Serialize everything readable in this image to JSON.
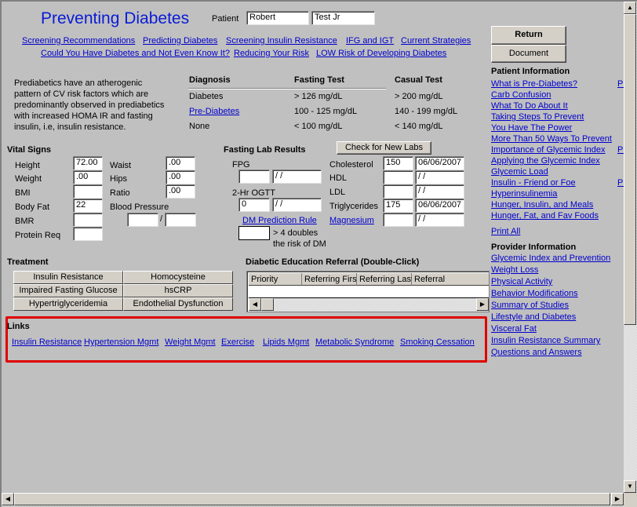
{
  "header": {
    "title": "Preventing Diabetes",
    "patient_label": "Patient",
    "first_name": "Robert",
    "last_name": "Test Jr"
  },
  "top_links": [
    "Screening Recommendations",
    "Predicting Diabetes",
    "Screening Insulin Resistance",
    "IFG and IGT",
    "Current Strategies",
    "Could You Have Diabetes and Not Even Know It?",
    "Reducing Your Risk",
    "LOW Risk of Developing Diabetes"
  ],
  "intro_text": "Prediabetics  have an atherogenic pattern of CV risk factors which are predominantly observed in prediabetics with increased HOMA IR and fasting insulin, i.e, insulin resistance.",
  "diagnosis_table": {
    "headers": [
      "Diagnosis",
      "Fasting Test",
      "Casual Test"
    ],
    "rows": [
      [
        "Diabetes",
        "> 126 mg/dL",
        "> 200 mg/dL"
      ],
      [
        "Pre-Diabetes",
        "100 - 125 mg/dL",
        "140 - 199 mg/dL"
      ],
      [
        "None",
        "< 100 mg/dL",
        "< 140 mg/dL"
      ]
    ]
  },
  "vitals": {
    "title": "Vital Signs",
    "height": {
      "label": "Height",
      "value": "72.00"
    },
    "weight": {
      "label": "Weight",
      "value": ".00"
    },
    "bmi": {
      "label": "BMI",
      "value": ""
    },
    "body_fat": {
      "label": "Body Fat",
      "value": "22"
    },
    "bmr": {
      "label": "BMR",
      "value": ""
    },
    "protein": {
      "label": "Protein Req",
      "value": ""
    },
    "waist": {
      "label": "Waist",
      "value": ".00"
    },
    "hips": {
      "label": "Hips",
      "value": ".00"
    },
    "ratio": {
      "label": "Ratio",
      "value": ".00"
    },
    "bp": {
      "label": "Blood Pressure",
      "sys": "",
      "dia": "",
      "sep": "/"
    }
  },
  "labs": {
    "title": "Fasting Lab Results",
    "check_button": "Check for New Labs",
    "fpg": {
      "label": "FPG",
      "value": "",
      "date": " / /"
    },
    "ogtt": {
      "label": "2-Hr OGTT",
      "value": "0",
      "date": " / /"
    },
    "dm_rule": "DM Prediction Rule",
    "dm_value": "",
    "dm_note1": "> 4 doubles",
    "dm_note2": "the risk of DM",
    "cholesterol": {
      "label": "Cholesterol",
      "value": "150",
      "date": "06/06/2007"
    },
    "hdl": {
      "label": "HDL",
      "value": "",
      "date": " / /"
    },
    "ldl": {
      "label": "LDL",
      "value": "",
      "date": " / /"
    },
    "trig": {
      "label": "Triglycerides",
      "value": "175",
      "date": "06/06/2007"
    },
    "magnesium": {
      "label": "Magnesium",
      "value": "",
      "date": " / /"
    }
  },
  "treatment": {
    "title": "Treatment",
    "items": [
      "Insulin Resistance",
      "Homocysteine",
      "Impaired Fasting Glucose",
      "hsCRP",
      "Hypertriglyceridemia",
      "Endothelial Dysfunction"
    ]
  },
  "referral": {
    "title": "Diabetic Education Referral (Double-Click)",
    "columns": [
      "Priority",
      "Referring First",
      "Referring Last",
      "Referral"
    ]
  },
  "links": {
    "title": "Links",
    "items": [
      "Insulin Resistance",
      "Hypertension Mgmt",
      "Weight Mgmt",
      "Exercise",
      "Lipids Mgmt",
      "Metabolic Syndrome",
      "Smoking Cessation"
    ],
    "highlight_color": "#e00000"
  },
  "side": {
    "return": "Return",
    "document": "Document",
    "patient_title": "Patient Information",
    "patient_links": [
      "What is Pre-Diabetes?",
      "Carb Confusion",
      "What To Do About It",
      "Taking Steps To Prevent",
      "You Have The Power",
      "More Than 50 Ways To Prevent",
      "Importance of Glycemic Index",
      "Applying the Glycemic Index",
      "Glycemic Load",
      "Insulin - Friend or Foe",
      "Hyperinsulinemia",
      "Hunger, Insulin, and Meals",
      "Hunger, Fat, and Fav Foods"
    ],
    "truncated": "Pr",
    "print_all": "Print All",
    "provider_title": "Provider Information",
    "provider_links": [
      "Glycemic Index and Prevention",
      "Weight Loss",
      "Physical Activity",
      "Behavior Modifications",
      "Summary of Studies",
      "Lifestyle and Diabetes",
      "Visceral Fat",
      "Insulin Resistance Summary",
      "Questions and Answers"
    ]
  }
}
